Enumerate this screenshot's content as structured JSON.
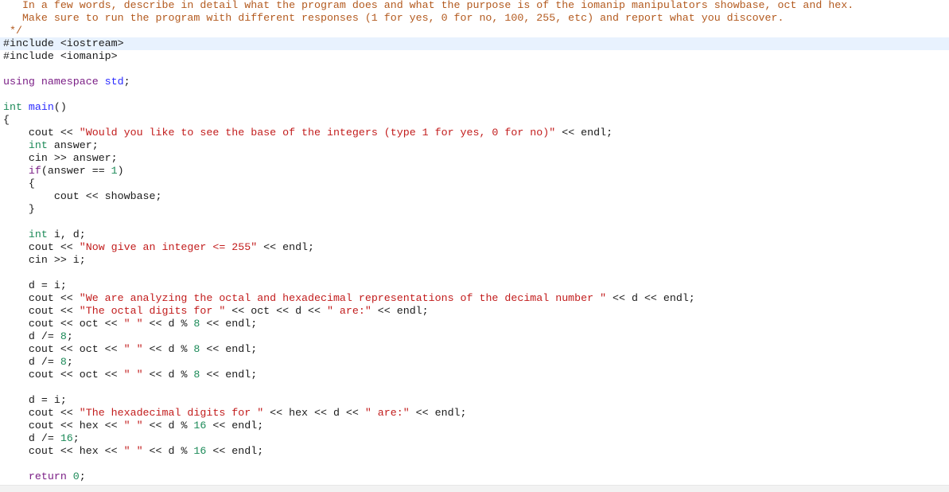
{
  "colors": {
    "comment": "#b35a1f",
    "type": "#1c8a58",
    "keyword": "#7b1f86",
    "function": "#2a2aff",
    "string": "#c21c1c",
    "number": "#1c8a58",
    "plain": "#1a1a1a",
    "current_line": "#e8f2fe"
  },
  "code": {
    "current_line_index": 3,
    "lines": [
      [
        {
          "t": "comment",
          "s": "   In a few words, describe in detail what the program does and what the purpose is of the iomanip manipulators showbase, oct and hex."
        }
      ],
      [
        {
          "t": "comment",
          "s": "   Make sure to run the program with different responses (1 for yes, 0 for no, 100, 255, etc) and report what you discover."
        }
      ],
      [
        {
          "t": "comment",
          "s": " */"
        }
      ],
      [
        {
          "t": "plain",
          "s": "#include <iostream>"
        }
      ],
      [
        {
          "t": "plain",
          "s": "#include <iomanip>"
        }
      ],
      [],
      [
        {
          "t": "keyword",
          "s": "using namespace "
        },
        {
          "t": "func",
          "s": "std"
        },
        {
          "t": "plain",
          "s": ";"
        }
      ],
      [],
      [
        {
          "t": "type",
          "s": "int "
        },
        {
          "t": "func",
          "s": "main"
        },
        {
          "t": "plain",
          "s": "()"
        }
      ],
      [
        {
          "t": "plain",
          "s": "{"
        }
      ],
      [
        {
          "t": "plain",
          "s": "    cout << "
        },
        {
          "t": "string",
          "s": "\"Would you like to see the base of the integers (type 1 for yes, 0 for no)\""
        },
        {
          "t": "plain",
          "s": " << endl;"
        }
      ],
      [
        {
          "t": "type",
          "s": "    int"
        },
        {
          "t": "plain",
          "s": " answer;"
        }
      ],
      [
        {
          "t": "plain",
          "s": "    cin >> answer;"
        }
      ],
      [
        {
          "t": "keyword",
          "s": "    if"
        },
        {
          "t": "plain",
          "s": "(answer == "
        },
        {
          "t": "number",
          "s": "1"
        },
        {
          "t": "plain",
          "s": ")"
        }
      ],
      [
        {
          "t": "plain",
          "s": "    {"
        }
      ],
      [
        {
          "t": "plain",
          "s": "        cout << showbase;"
        }
      ],
      [
        {
          "t": "plain",
          "s": "    }"
        }
      ],
      [],
      [
        {
          "t": "type",
          "s": "    int"
        },
        {
          "t": "plain",
          "s": " i, d;"
        }
      ],
      [
        {
          "t": "plain",
          "s": "    cout << "
        },
        {
          "t": "string",
          "s": "\"Now give an integer <= 255\""
        },
        {
          "t": "plain",
          "s": " << endl;"
        }
      ],
      [
        {
          "t": "plain",
          "s": "    cin >> i;"
        }
      ],
      [],
      [
        {
          "t": "plain",
          "s": "    d = i;"
        }
      ],
      [
        {
          "t": "plain",
          "s": "    cout << "
        },
        {
          "t": "string",
          "s": "\"We are analyzing the octal and hexadecimal representations of the decimal number \""
        },
        {
          "t": "plain",
          "s": " << d << endl;"
        }
      ],
      [
        {
          "t": "plain",
          "s": "    cout << "
        },
        {
          "t": "string",
          "s": "\"The octal digits for \""
        },
        {
          "t": "plain",
          "s": " << oct << d << "
        },
        {
          "t": "string",
          "s": "\" are:\""
        },
        {
          "t": "plain",
          "s": " << endl;"
        }
      ],
      [
        {
          "t": "plain",
          "s": "    cout << oct << "
        },
        {
          "t": "string",
          "s": "\" \""
        },
        {
          "t": "plain",
          "s": " << d % "
        },
        {
          "t": "number",
          "s": "8"
        },
        {
          "t": "plain",
          "s": " << endl;"
        }
      ],
      [
        {
          "t": "plain",
          "s": "    d /= "
        },
        {
          "t": "number",
          "s": "8"
        },
        {
          "t": "plain",
          "s": ";"
        }
      ],
      [
        {
          "t": "plain",
          "s": "    cout << oct << "
        },
        {
          "t": "string",
          "s": "\" \""
        },
        {
          "t": "plain",
          "s": " << d % "
        },
        {
          "t": "number",
          "s": "8"
        },
        {
          "t": "plain",
          "s": " << endl;"
        }
      ],
      [
        {
          "t": "plain",
          "s": "    d /= "
        },
        {
          "t": "number",
          "s": "8"
        },
        {
          "t": "plain",
          "s": ";"
        }
      ],
      [
        {
          "t": "plain",
          "s": "    cout << oct << "
        },
        {
          "t": "string",
          "s": "\" \""
        },
        {
          "t": "plain",
          "s": " << d % "
        },
        {
          "t": "number",
          "s": "8"
        },
        {
          "t": "plain",
          "s": " << endl;"
        }
      ],
      [],
      [
        {
          "t": "plain",
          "s": "    d = i;"
        }
      ],
      [
        {
          "t": "plain",
          "s": "    cout << "
        },
        {
          "t": "string",
          "s": "\"The hexadecimal digits for \""
        },
        {
          "t": "plain",
          "s": " << hex << d << "
        },
        {
          "t": "string",
          "s": "\" are:\""
        },
        {
          "t": "plain",
          "s": " << endl;"
        }
      ],
      [
        {
          "t": "plain",
          "s": "    cout << hex << "
        },
        {
          "t": "string",
          "s": "\" \""
        },
        {
          "t": "plain",
          "s": " << d % "
        },
        {
          "t": "number",
          "s": "16"
        },
        {
          "t": "plain",
          "s": " << endl;"
        }
      ],
      [
        {
          "t": "plain",
          "s": "    d /= "
        },
        {
          "t": "number",
          "s": "16"
        },
        {
          "t": "plain",
          "s": ";"
        }
      ],
      [
        {
          "t": "plain",
          "s": "    cout << hex << "
        },
        {
          "t": "string",
          "s": "\" \""
        },
        {
          "t": "plain",
          "s": " << d % "
        },
        {
          "t": "number",
          "s": "16"
        },
        {
          "t": "plain",
          "s": " << endl;"
        }
      ],
      [],
      [
        {
          "t": "keyword",
          "s": "    return "
        },
        {
          "t": "number",
          "s": "0"
        },
        {
          "t": "plain",
          "s": ";"
        }
      ]
    ]
  }
}
